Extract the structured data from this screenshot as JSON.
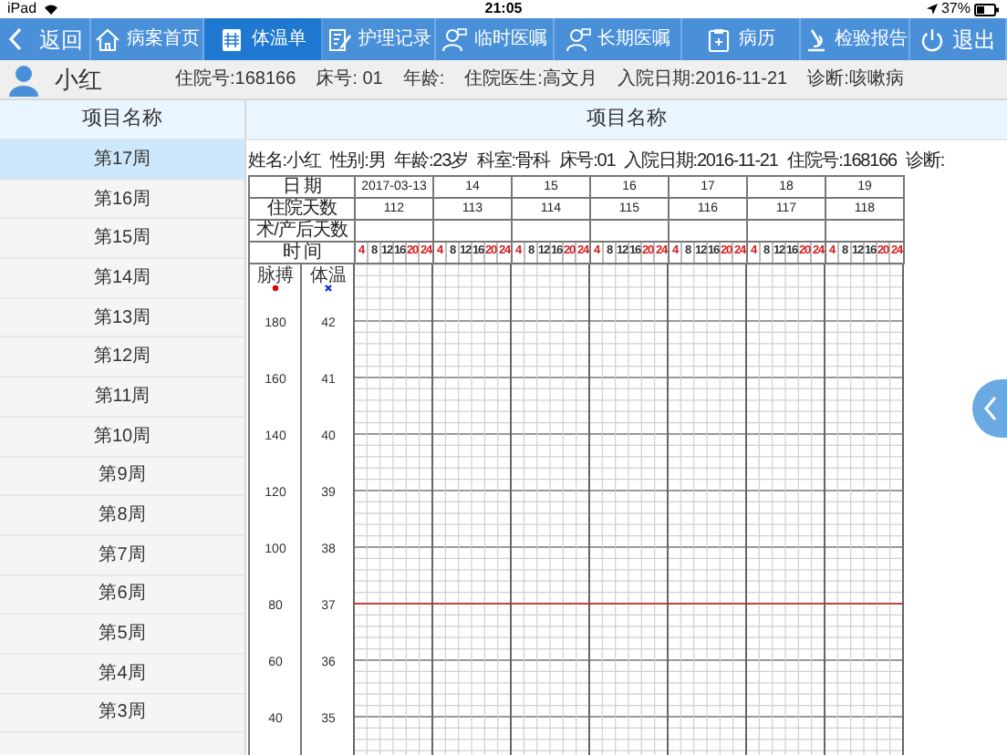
{
  "status_bar": {
    "device": "iPad",
    "time": "21:05",
    "battery": "37%"
  },
  "nav": [
    {
      "label": "返回",
      "kind": "back",
      "selected": false
    },
    {
      "label": "病案首页",
      "kind": "home",
      "selected": false
    },
    {
      "label": "体温单",
      "kind": "chart",
      "selected": true
    },
    {
      "label": "护理记录",
      "kind": "edit",
      "selected": false
    },
    {
      "label": "临时医嘱",
      "kind": "doctor",
      "selected": false
    },
    {
      "label": "长期医嘱",
      "kind": "doctor",
      "selected": false
    },
    {
      "label": "病历",
      "kind": "clipboard",
      "selected": false
    },
    {
      "label": "检验报告",
      "kind": "microscope",
      "selected": false
    },
    {
      "label": "退出",
      "kind": "power",
      "selected": false
    }
  ],
  "patient": {
    "name": "小红",
    "fields": [
      "住院号:168166",
      "床号: 01",
      "年龄:",
      "住院医生:高文月",
      "入院日期:2016-11-21",
      "诊断:咳嗽病"
    ]
  },
  "sidebar": {
    "header": "项目名称",
    "items": [
      {
        "label": "第17周",
        "selected": true
      },
      {
        "label": "第16周",
        "selected": false
      },
      {
        "label": "第15周",
        "selected": false
      },
      {
        "label": "第14周",
        "selected": false
      },
      {
        "label": "第13周",
        "selected": false
      },
      {
        "label": "第12周",
        "selected": false
      },
      {
        "label": "第11周",
        "selected": false
      },
      {
        "label": "第10周",
        "selected": false
      },
      {
        "label": "第9周",
        "selected": false
      },
      {
        "label": "第8周",
        "selected": false
      },
      {
        "label": "第7周",
        "selected": false
      },
      {
        "label": "第6周",
        "selected": false
      },
      {
        "label": "第5周",
        "selected": false
      },
      {
        "label": "第4周",
        "selected": false
      },
      {
        "label": "第3周",
        "selected": false
      }
    ]
  },
  "sheet": {
    "header": "项目名称",
    "info": [
      "姓名:小红",
      "性别:男",
      "年龄:23岁",
      "科室:骨科",
      "床号:01",
      "入院日期:2016-11-21",
      "住院号:168166",
      "诊断:"
    ],
    "row_labels": {
      "date": "日 期",
      "hospital_days": "住院天数",
      "postop_days": "术/产后天数",
      "time": "时 间",
      "pulse": "脉搏",
      "temperature": "体温"
    },
    "days": [
      {
        "date": "2017-03-13",
        "hospital_day": "112",
        "times": [
          {
            "label": "4",
            "color": "#d42020"
          },
          {
            "label": "8",
            "color": "#333333"
          },
          {
            "label": "12",
            "color": "#333333"
          },
          {
            "label": "16",
            "color": "#333333"
          },
          {
            "label": "20",
            "color": "#d42020"
          },
          {
            "label": "24",
            "color": "#d42020"
          }
        ]
      },
      {
        "date": "14",
        "hospital_day": "113",
        "times": [
          {
            "label": "4",
            "color": "#d42020"
          },
          {
            "label": "8",
            "color": "#333333"
          },
          {
            "label": "12",
            "color": "#333333"
          },
          {
            "label": "16",
            "color": "#333333"
          },
          {
            "label": "20",
            "color": "#d42020"
          },
          {
            "label": "24",
            "color": "#d42020"
          }
        ]
      },
      {
        "date": "15",
        "hospital_day": "114",
        "times": [
          {
            "label": "4",
            "color": "#d42020"
          },
          {
            "label": "8",
            "color": "#333333"
          },
          {
            "label": "12",
            "color": "#333333"
          },
          {
            "label": "16",
            "color": "#333333"
          },
          {
            "label": "20",
            "color": "#d42020"
          },
          {
            "label": "24",
            "color": "#d42020"
          }
        ]
      },
      {
        "date": "16",
        "hospital_day": "115",
        "times": [
          {
            "label": "4",
            "color": "#d42020"
          },
          {
            "label": "8",
            "color": "#333333"
          },
          {
            "label": "12",
            "color": "#333333"
          },
          {
            "label": "16",
            "color": "#333333"
          },
          {
            "label": "20",
            "color": "#d42020"
          },
          {
            "label": "24",
            "color": "#d42020"
          }
        ]
      },
      {
        "date": "17",
        "hospital_day": "116",
        "times": [
          {
            "label": "4",
            "color": "#d42020"
          },
          {
            "label": "8",
            "color": "#333333"
          },
          {
            "label": "12",
            "color": "#333333"
          },
          {
            "label": "16",
            "color": "#333333"
          },
          {
            "label": "20",
            "color": "#d42020"
          },
          {
            "label": "24",
            "color": "#d42020"
          }
        ]
      },
      {
        "date": "18",
        "hospital_day": "117",
        "times": [
          {
            "label": "4",
            "color": "#d42020"
          },
          {
            "label": "8",
            "color": "#333333"
          },
          {
            "label": "12",
            "color": "#333333"
          },
          {
            "label": "16",
            "color": "#333333"
          },
          {
            "label": "20",
            "color": "#d42020"
          },
          {
            "label": "24",
            "color": "#d42020"
          }
        ]
      },
      {
        "date": "19",
        "hospital_day": "118",
        "times": [
          {
            "label": "4",
            "color": "#d42020"
          },
          {
            "label": "8",
            "color": "#333333"
          },
          {
            "label": "12",
            "color": "#333333"
          },
          {
            "label": "16",
            "color": "#333333"
          },
          {
            "label": "20",
            "color": "#d42020"
          },
          {
            "label": "24",
            "color": "#d42020"
          }
        ]
      }
    ],
    "pulse_scale": [
      "180",
      "160",
      "140",
      "120",
      "100",
      "80",
      "60",
      "40"
    ],
    "temperature_scale": [
      "42",
      "41",
      "40",
      "39",
      "38",
      "37",
      "36",
      "35"
    ]
  }
}
